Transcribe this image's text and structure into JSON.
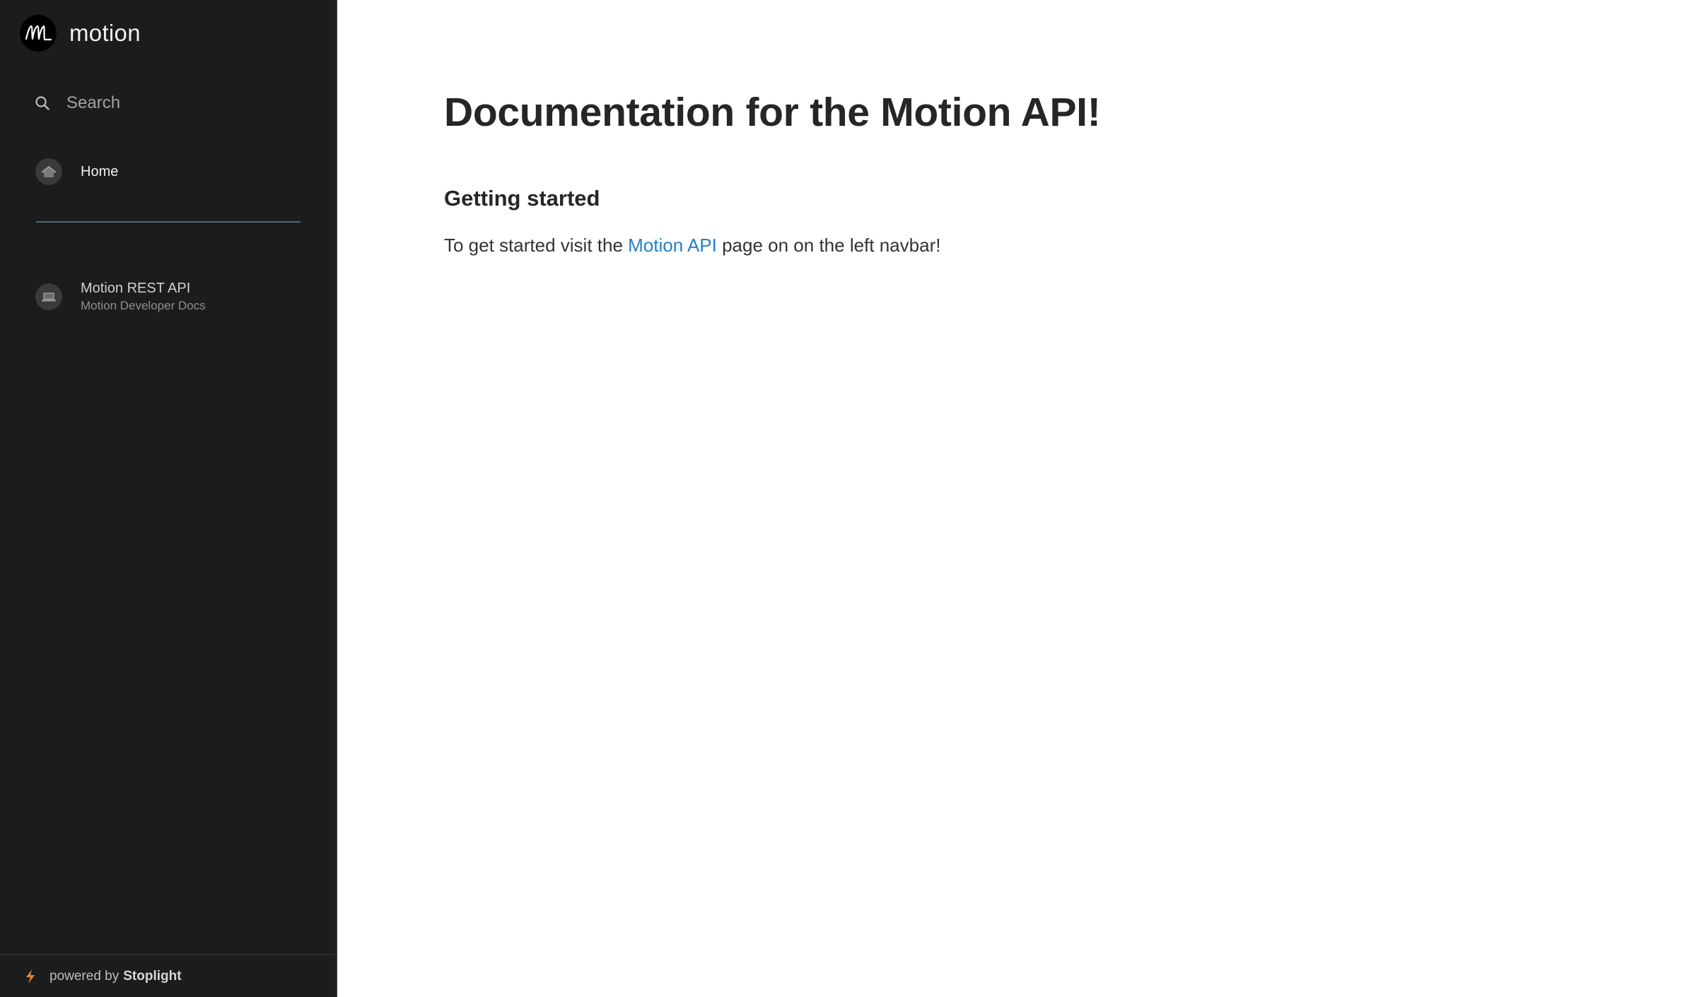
{
  "sidebar": {
    "brand": {
      "name": "motion"
    },
    "search": {
      "label": "Search"
    },
    "nav": {
      "home_label": "Home"
    },
    "project": {
      "title": "Motion REST API",
      "subtitle": "Motion Developer Docs"
    },
    "footer": {
      "powered_by": "powered by",
      "brand": "Stoplight"
    }
  },
  "main": {
    "title": "Documentation for the Motion API!",
    "section_heading": "Getting started",
    "intro": {
      "before": "To get started visit the ",
      "link": "Motion API",
      "after": " page on on the left navbar!"
    }
  },
  "colors": {
    "sidebar_bg": "#1c1c1c",
    "link": "#2480c7",
    "bolt": "#e0873a"
  },
  "icons": {
    "brand": "motion-logo-icon",
    "search": "search-icon",
    "home": "home-icon",
    "project": "laptop-icon",
    "footer": "bolt-icon"
  }
}
